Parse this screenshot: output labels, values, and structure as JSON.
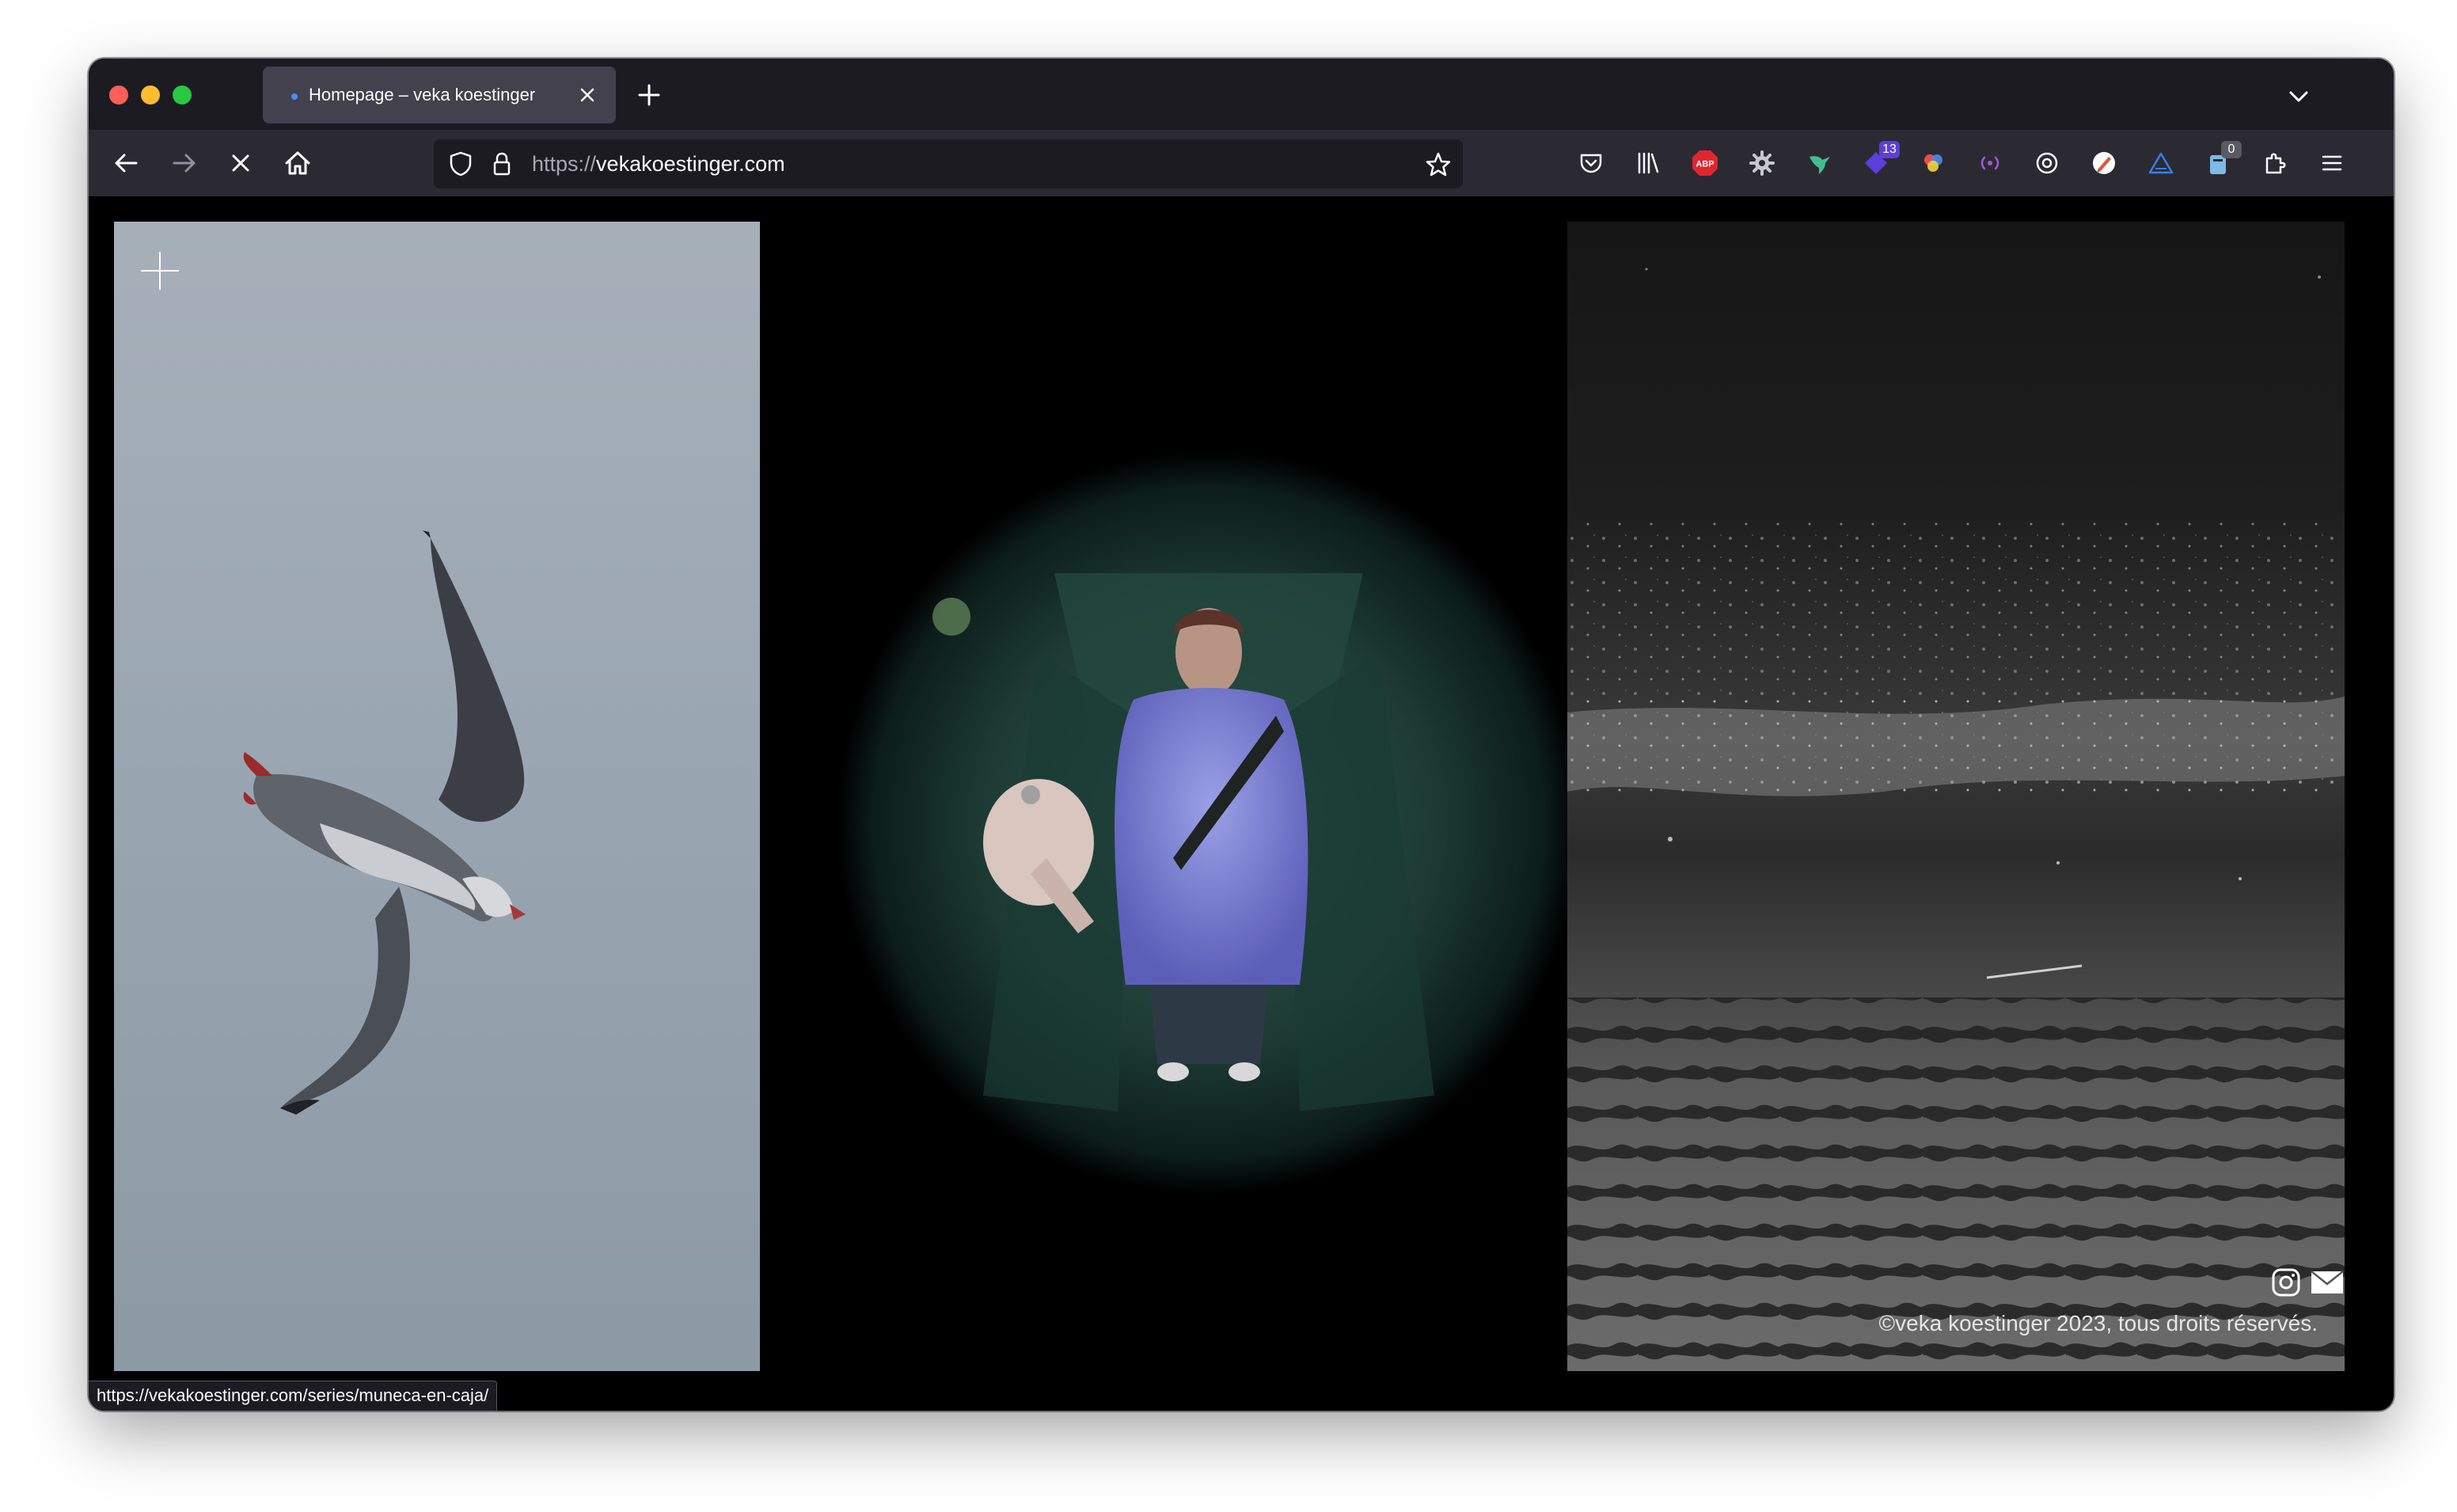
{
  "browser": {
    "tab": {
      "title": "Homepage – veka koestinger"
    },
    "url": {
      "scheme": "https://",
      "host": "vekakoestinger.com"
    },
    "extensions": [
      {
        "name": "pocket-icon"
      },
      {
        "name": "library-icon"
      },
      {
        "name": "adblock-icon",
        "label": "ABP"
      },
      {
        "name": "settings-gear-icon"
      },
      {
        "name": "hummingbird-icon"
      },
      {
        "name": "extension-badge-icon",
        "badge": "13"
      },
      {
        "name": "color-dots-icon"
      },
      {
        "name": "broadcast-icon"
      },
      {
        "name": "sync-icon"
      },
      {
        "name": "pen-icon"
      },
      {
        "name": "triangle-icon"
      },
      {
        "name": "clipboard-icon",
        "badge": "0"
      },
      {
        "name": "extensions-puzzle-icon"
      },
      {
        "name": "menu-icon"
      }
    ]
  },
  "page": {
    "footer_text": "©veka koestinger 2023, tous droits réservés.",
    "status_link": "https://vekakoestinger.com/series/muneca-en-caja/"
  },
  "colors": {
    "tabbar": "#1c1b22",
    "navbar": "#2b2a33",
    "active_tab": "#42414d",
    "page_background": "#000000"
  }
}
